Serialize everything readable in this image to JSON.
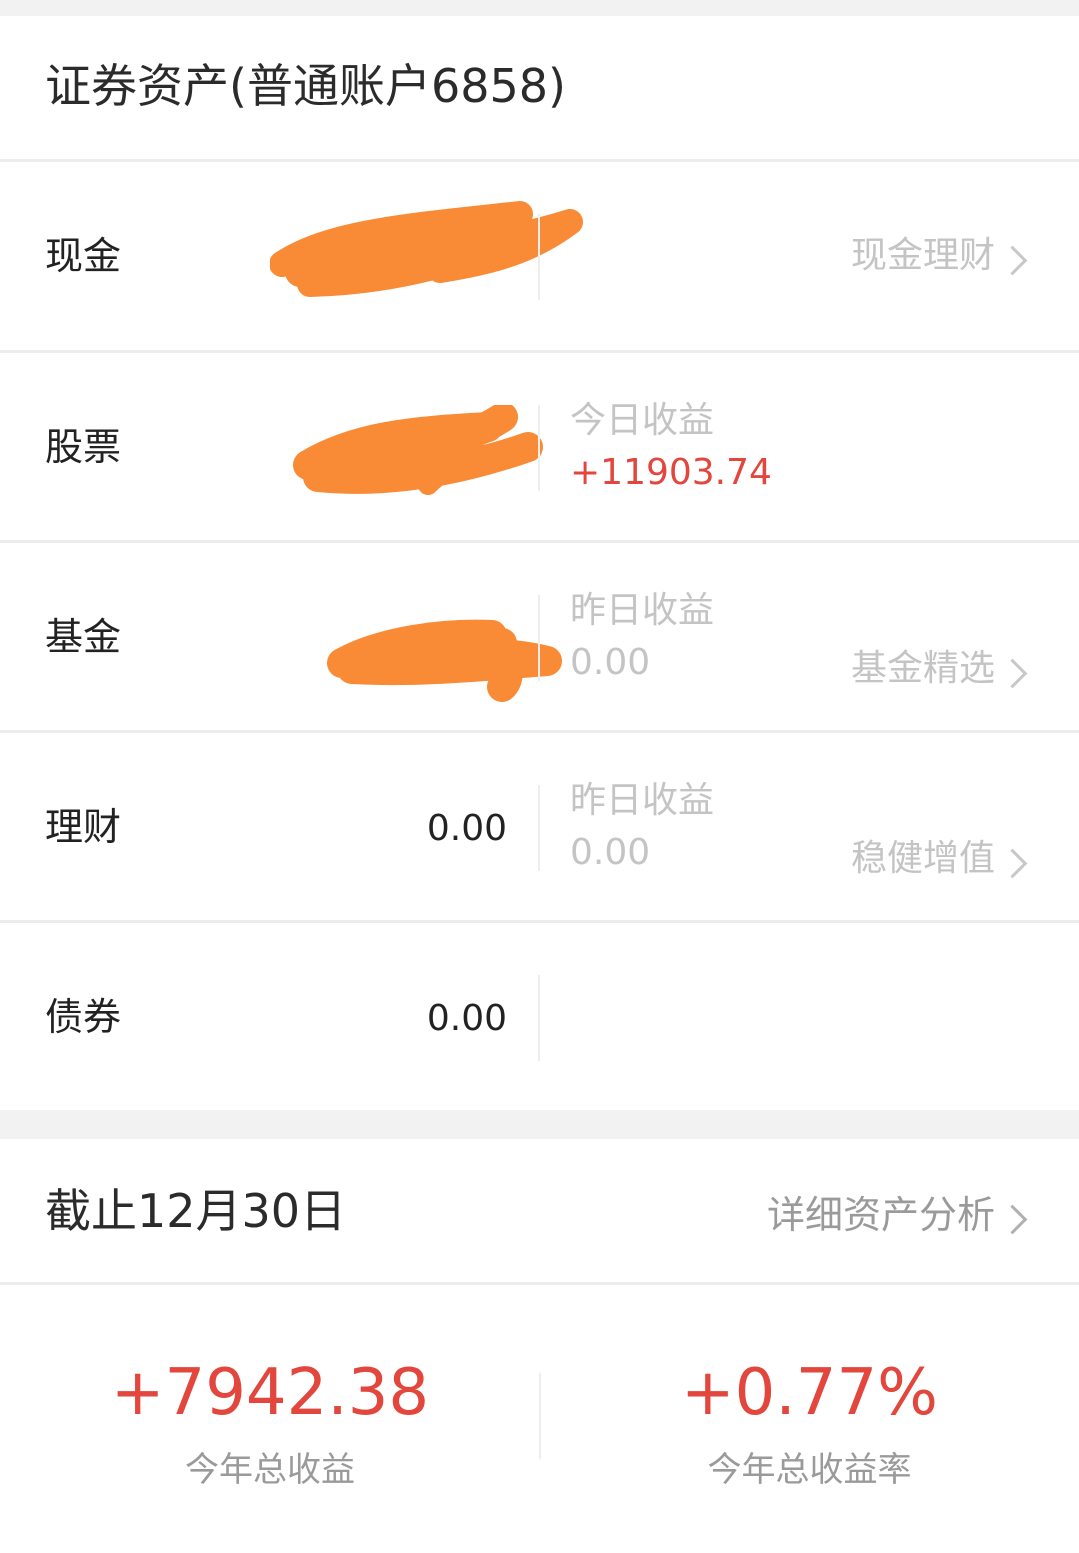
{
  "header": {
    "title": "证券资产(普通账户6858)"
  },
  "rows": [
    {
      "label": "现金",
      "link": "现金理财"
    },
    {
      "label": "股票",
      "sub_label": "今日收益",
      "sub_value": "+11903.74"
    },
    {
      "label": "基金",
      "sub_label": "昨日收益",
      "sub_value": "0.00",
      "link": "基金精选"
    },
    {
      "label": "理财",
      "value": "0.00",
      "sub_label": "昨日收益",
      "sub_value": "0.00",
      "link": "稳健增值"
    },
    {
      "label": "债券",
      "value": "0.00"
    }
  ],
  "summary": {
    "date_label": "截止12月30日",
    "link": "详细资产分析",
    "total_profit": "+7942.38",
    "total_profit_label": "今年总收益",
    "total_rate": "+0.77%",
    "total_rate_label": "今年总收益率"
  },
  "colors": {
    "profit_red": "#e2463c",
    "scribble_orange": "#f98b36"
  }
}
